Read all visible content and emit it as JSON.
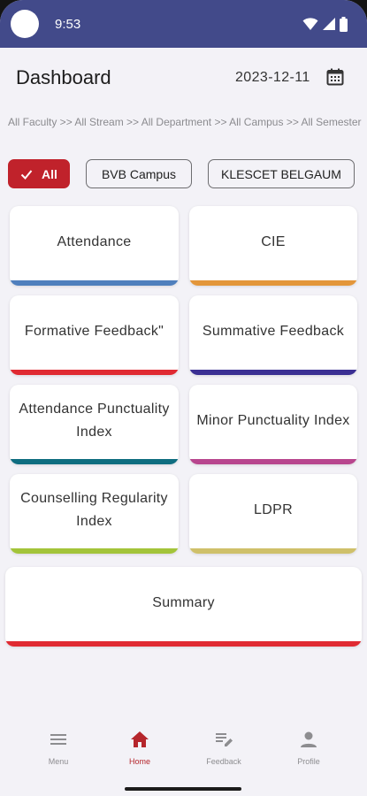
{
  "status_bar": {
    "time": "9:53"
  },
  "header": {
    "title": "Dashboard",
    "date": "2023-12-11"
  },
  "breadcrumb": "All Faculty >> All Stream >> All Department >> All Campus >> All Semester",
  "filters": [
    {
      "label": "All",
      "selected": true
    },
    {
      "label": "BVB Campus",
      "selected": false
    },
    {
      "label": "KLESCET BELGAUM",
      "selected": false
    }
  ],
  "cards": [
    {
      "label": "Attendance",
      "color": "#4f7fbd"
    },
    {
      "label": "CIE",
      "color": "#e3963a"
    },
    {
      "label": "Formative Feedback\"",
      "color": "#e02a32"
    },
    {
      "label": "Summative Feedback",
      "color": "#3b2f93"
    },
    {
      "label": "Attendance Punctuality Index",
      "color": "#0f6d80"
    },
    {
      "label": "Minor Punctuality Index",
      "color": "#b8468e"
    },
    {
      "label": "Counselling Regularity Index",
      "color": "#a3c43a"
    },
    {
      "label": "LDPR",
      "color": "#cfc06a"
    },
    {
      "label": "Summary",
      "color": "#e02a32"
    }
  ],
  "bottom_nav": [
    {
      "label": "Menu",
      "icon": "menu-icon",
      "active": false
    },
    {
      "label": "Home",
      "icon": "home-icon",
      "active": true
    },
    {
      "label": "Feedback",
      "icon": "feedback-icon",
      "active": false
    },
    {
      "label": "Profile",
      "icon": "profile-icon",
      "active": false
    }
  ],
  "colors": {
    "status_bar": "#424a8a",
    "accent": "#c0222b",
    "background": "#f3f2f7"
  }
}
